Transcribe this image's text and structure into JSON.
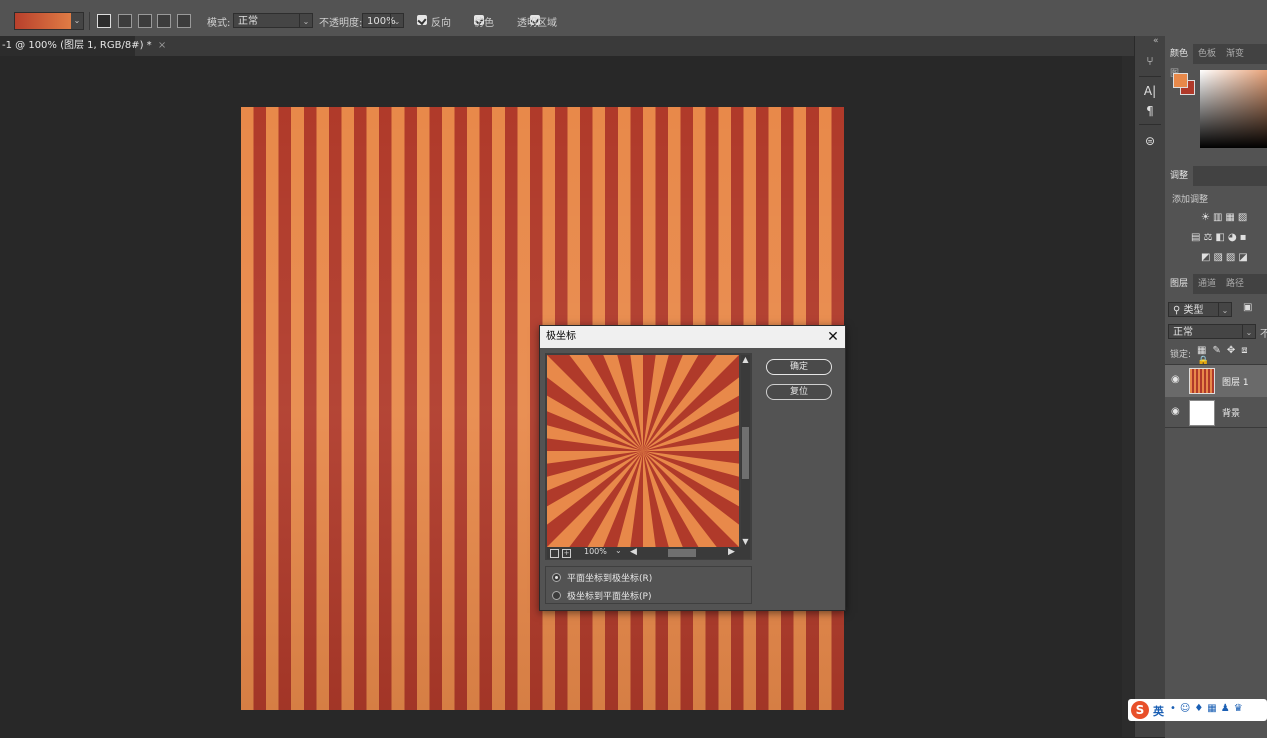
{
  "options_bar": {
    "mode_label": "模式:",
    "mode_value": "正常",
    "opacity_label": "不透明度:",
    "opacity_value": "100%",
    "reverse_label": "反向",
    "dither_label": "仿色",
    "transparency_label": "透明区域"
  },
  "document_tab": {
    "title": "-1 @ 100% (图层 1, RGB/8#) *",
    "close": "×"
  },
  "panels": {
    "color_tabs": [
      "颜色",
      "色板",
      "渐变",
      "图"
    ],
    "adjust_tab": "调整",
    "adjust_add_label": "添加调整",
    "layers_tabs": [
      "图层",
      "通道",
      "路径"
    ],
    "filter_kind": "类型",
    "blend_mode": "正常",
    "blend_mode_more": "不",
    "lock_label": "锁定:",
    "layers": [
      {
        "name": "图层 1"
      },
      {
        "name": "背景"
      }
    ]
  },
  "dialog": {
    "title": "极坐标",
    "ok_label": "确定",
    "reset_label": "复位",
    "zoom_value": "100%",
    "option_rect_to_polar": "平面坐标到极坐标(R)",
    "option_polar_to_rect": "极坐标到平面坐标(P)",
    "selected_option": "rect_to_polar"
  },
  "ime": {
    "lang": "英"
  },
  "colors": {
    "stripe_light": "#e8894a",
    "stripe_dark": "#b03a2a",
    "foreground": "#e8894a",
    "background_swatch": "#b03a2a"
  }
}
